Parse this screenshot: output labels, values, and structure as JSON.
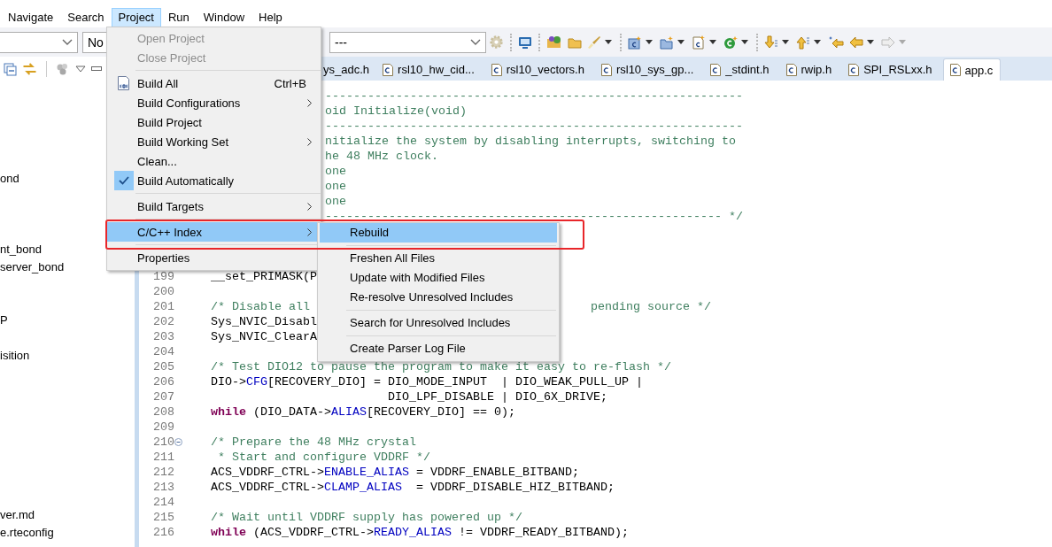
{
  "menu_bar": [
    {
      "label": "Navigate",
      "selected": false
    },
    {
      "label": "Search",
      "selected": false
    },
    {
      "label": "Project",
      "selected": true
    },
    {
      "label": "Run",
      "selected": false
    },
    {
      "label": "Window",
      "selected": false
    },
    {
      "label": "Help",
      "selected": false
    }
  ],
  "toolbar": {
    "launch_mode_value": "No",
    "launch_target_value": "---"
  },
  "project_explorer": {
    "tree_items": [
      {
        "label": "ond"
      },
      {
        "label": "nt_bond"
      },
      {
        "label": "server_bond"
      },
      {
        "label": "P"
      },
      {
        "label": "isition"
      },
      {
        "label": "ver.md"
      },
      {
        "label": "e.rteconfig"
      }
    ]
  },
  "editor_tabs": [
    {
      "label": "ys_adc.h",
      "selected": false,
      "icon": false
    },
    {
      "label": "rsl10_hw_cid...",
      "selected": false,
      "icon": true
    },
    {
      "label": "rsl10_vectors.h",
      "selected": false,
      "icon": true
    },
    {
      "label": "rsl10_sys_gp...",
      "selected": false,
      "icon": true
    },
    {
      "label": "_stdint.h",
      "selected": false,
      "icon": true
    },
    {
      "label": "rwip.h",
      "selected": false,
      "icon": true
    },
    {
      "label": "SPI_RSLxx.h",
      "selected": false,
      "icon": true
    },
    {
      "label": "app.c",
      "selected": true,
      "icon": true
    }
  ],
  "editor": {
    "covered_lines": [
      {
        "text": "-----------------------------------------------------------"
      },
      {
        "text": "oid Initialize(void)"
      },
      {
        "text": "-----------------------------------------------------------"
      },
      {
        "text": "nitialize the system by disabling interrupts, switching to"
      },
      {
        "text": "he 48 MHz clock."
      },
      {
        "text": "one"
      },
      {
        "text": "one"
      },
      {
        "text": "one"
      },
      {
        "text": "-------------------------------------------------------- */"
      }
    ],
    "lines": [
      {
        "number": "199",
        "fold": false,
        "parts": [
          {
            "text": "__set_PRIMASK(P",
            "kind": "plain"
          }
        ]
      },
      {
        "number": "200",
        "fold": false
      },
      {
        "number": "201",
        "fold": false,
        "parts": [
          {
            "text": "/* Disable all",
            "kind": "comment"
          }
        ],
        "tail": {
          "text": "pending source */",
          "kind": "comment"
        }
      },
      {
        "number": "202",
        "fold": false,
        "parts": [
          {
            "text": "Sys_NVIC_Disabl",
            "kind": "plain"
          }
        ]
      },
      {
        "number": "203",
        "fold": false,
        "parts": [
          {
            "text": "Sys_NVIC_ClearA",
            "kind": "plain"
          }
        ]
      },
      {
        "number": "204",
        "fold": false
      },
      {
        "number": "205",
        "fold": false,
        "parts": [
          {
            "text": "/* Test DIO12 to pause the program to make it easy to re-flash */",
            "kind": "comment"
          }
        ]
      },
      {
        "number": "206",
        "fold": false,
        "parts": [
          {
            "text": "DIO->",
            "kind": "plain"
          },
          {
            "text": "CFG",
            "kind": "field"
          },
          {
            "text": "[RECOVERY_DIO] = DIO_MODE_INPUT  | DIO_WEAK_PULL_UP |",
            "kind": "plain"
          }
        ]
      },
      {
        "number": "207",
        "fold": false,
        "parts": [
          {
            "text": "                         DIO_LPF_DISABLE | DIO_6X_DRIVE;",
            "kind": "plain"
          }
        ]
      },
      {
        "number": "208",
        "fold": false,
        "parts": [
          {
            "text": "while",
            "kind": "keyword"
          },
          {
            "text": " (DIO_DATA->",
            "kind": "plain"
          },
          {
            "text": "ALIAS",
            "kind": "field"
          },
          {
            "text": "[RECOVERY_DIO] == 0);",
            "kind": "plain"
          }
        ]
      },
      {
        "number": "209",
        "fold": false
      },
      {
        "number": "210",
        "fold": true,
        "parts": [
          {
            "text": "/* Prepare the 48 MHz crystal",
            "kind": "comment"
          }
        ]
      },
      {
        "number": "211",
        "fold": false,
        "parts": [
          {
            "text": " * Start and configure VDDRF */",
            "kind": "comment"
          }
        ]
      },
      {
        "number": "212",
        "fold": false,
        "parts": [
          {
            "text": "ACS_VDDRF_CTRL->",
            "kind": "plain"
          },
          {
            "text": "ENABLE_ALIAS",
            "kind": "field"
          },
          {
            "text": " = VDDRF_ENABLE_BITBAND;",
            "kind": "plain"
          }
        ]
      },
      {
        "number": "213",
        "fold": false,
        "parts": [
          {
            "text": "ACS_VDDRF_CTRL->",
            "kind": "plain"
          },
          {
            "text": "CLAMP_ALIAS",
            "kind": "field"
          },
          {
            "text": "  = VDDRF_DISABLE_HIZ_BITBAND;",
            "kind": "plain"
          }
        ]
      },
      {
        "number": "214",
        "fold": false
      },
      {
        "number": "215",
        "fold": false,
        "parts": [
          {
            "text": "/* Wait until VDDRF supply has powered up */",
            "kind": "comment"
          }
        ]
      },
      {
        "number": "216",
        "fold": false,
        "parts": [
          {
            "text": "while",
            "kind": "keyword"
          },
          {
            "text": " (ACS_VDDRF_CTRL->",
            "kind": "plain"
          },
          {
            "text": "READY_ALIAS",
            "kind": "field"
          },
          {
            "text": " != VDDRF_READY_BITBAND);",
            "kind": "plain"
          }
        ]
      }
    ]
  },
  "project_menu": {
    "items": [
      {
        "kind": "item",
        "label": "Open Project",
        "disabled": true,
        "checked": false,
        "submenu": false,
        "selected": false
      },
      {
        "kind": "item",
        "label": "Close Project",
        "disabled": true,
        "checked": false,
        "submenu": false,
        "selected": false
      },
      {
        "kind": "separator"
      },
      {
        "kind": "icon_item",
        "label": "Build All",
        "shortcut": "Ctrl+B",
        "disabled": false,
        "checked": false,
        "submenu": false,
        "selected": false
      },
      {
        "kind": "item",
        "label": "Build Configurations",
        "disabled": false,
        "checked": false,
        "submenu": true,
        "selected": false
      },
      {
        "kind": "item",
        "label": "Build Project",
        "disabled": false,
        "checked": false,
        "submenu": false,
        "selected": false
      },
      {
        "kind": "item",
        "label": "Build Working Set",
        "disabled": false,
        "checked": false,
        "submenu": true,
        "selected": false
      },
      {
        "kind": "item",
        "label": "Clean...",
        "disabled": false,
        "checked": false,
        "submenu": false,
        "selected": false
      },
      {
        "kind": "item",
        "label": "Build Automatically",
        "disabled": false,
        "checked": true,
        "submenu": false,
        "selected": false
      },
      {
        "kind": "separator"
      },
      {
        "kind": "item",
        "label": "Build Targets",
        "disabled": false,
        "checked": false,
        "submenu": true,
        "selected": false
      },
      {
        "kind": "separator"
      },
      {
        "kind": "item",
        "label": "C/C++ Index",
        "disabled": false,
        "checked": false,
        "submenu": true,
        "selected": true
      },
      {
        "kind": "separator"
      },
      {
        "kind": "item",
        "label": "Properties",
        "disabled": false,
        "checked": false,
        "submenu": false,
        "selected": false
      }
    ]
  },
  "index_submenu": {
    "items": [
      {
        "kind": "item",
        "label": "Rebuild",
        "disabled": false,
        "selected": true
      },
      {
        "kind": "separator"
      },
      {
        "kind": "item",
        "label": "Freshen All Files",
        "disabled": false,
        "selected": false
      },
      {
        "kind": "item",
        "label": "Update with Modified Files",
        "disabled": false,
        "selected": false
      },
      {
        "kind": "item",
        "label": "Re-resolve Unresolved Includes",
        "disabled": false,
        "selected": false
      },
      {
        "kind": "separator"
      },
      {
        "kind": "item",
        "label": "Search for Unresolved Includes",
        "disabled": false,
        "selected": false
      },
      {
        "kind": "separator"
      },
      {
        "kind": "item",
        "label": "Create Parser Log File",
        "disabled": false,
        "selected": false
      }
    ]
  }
}
